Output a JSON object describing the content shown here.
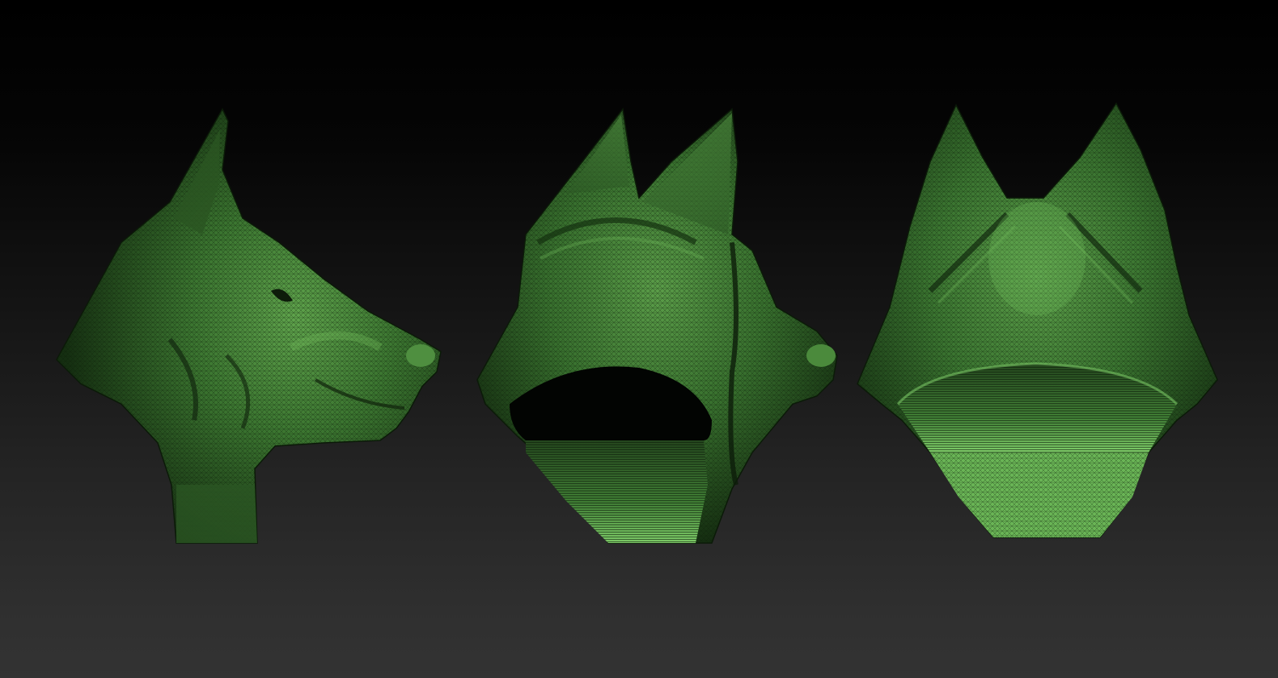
{
  "scene": {
    "background_top": "#000000",
    "background_bottom": "#333333",
    "mesh_color": "#3f7a34",
    "mesh_highlight": "#7fce6a",
    "mesh_shadow": "#0f240c",
    "views": [
      {
        "id": "side",
        "icon": "dog-head-side-view"
      },
      {
        "id": "three-quarter",
        "icon": "dog-head-three-quarter-view"
      },
      {
        "id": "back",
        "icon": "dog-head-back-view"
      }
    ]
  }
}
